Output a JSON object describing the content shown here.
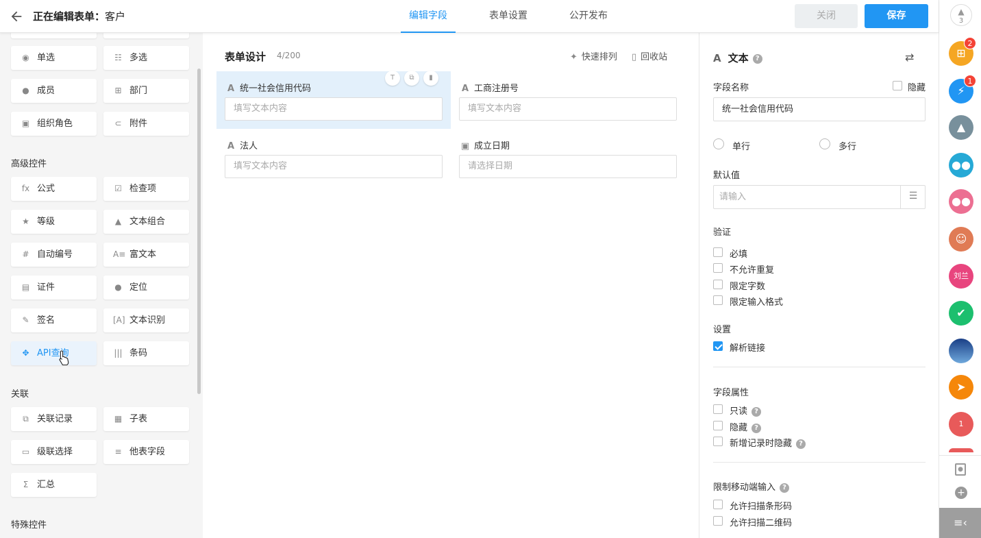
{
  "header": {
    "back_icon": "arrow-left-icon",
    "title_prefix": "正在编辑表单：",
    "title_name": "客户",
    "tabs": [
      {
        "label": "编辑字段",
        "active": true
      },
      {
        "label": "表单设置",
        "active": false
      },
      {
        "label": "公开发布",
        "active": false
      }
    ],
    "close_label": "关闭",
    "save_label": "保存",
    "accent_color": "#2196f3"
  },
  "controls": {
    "basic": [
      {
        "label": "单选",
        "icon": "radio-icon"
      },
      {
        "label": "多选",
        "icon": "checklist-icon"
      },
      {
        "label": "成员",
        "icon": "user-icon"
      },
      {
        "label": "部门",
        "icon": "org-tree-icon"
      },
      {
        "label": "组织角色",
        "icon": "role-icon"
      },
      {
        "label": "附件",
        "icon": "paperclip-icon"
      }
    ],
    "advanced_title": "高级控件",
    "advanced": [
      {
        "label": "公式",
        "icon": "fx-icon"
      },
      {
        "label": "检查项",
        "icon": "checkbox-icon"
      },
      {
        "label": "等级",
        "icon": "star-icon"
      },
      {
        "label": "文本组合",
        "icon": "shapes-icon"
      },
      {
        "label": "自动编号",
        "icon": "hash-icon"
      },
      {
        "label": "富文本",
        "icon": "richtext-icon"
      },
      {
        "label": "证件",
        "icon": "id-card-icon"
      },
      {
        "label": "定位",
        "icon": "location-pin-icon"
      },
      {
        "label": "签名",
        "icon": "signature-icon"
      },
      {
        "label": "文本识别",
        "icon": "ocr-icon"
      },
      {
        "label": "API查询",
        "icon": "api-icon",
        "highlight": true
      },
      {
        "label": "条码",
        "icon": "barcode-icon"
      }
    ],
    "relation_title": "关联",
    "relation": [
      {
        "label": "关联记录",
        "icon": "link-record-icon"
      },
      {
        "label": "子表",
        "icon": "table-icon"
      },
      {
        "label": "级联选择",
        "icon": "cascade-icon"
      },
      {
        "label": "他表字段",
        "icon": "lookup-icon"
      },
      {
        "label": "汇总",
        "icon": "sigma-icon"
      }
    ],
    "special_title": "特殊控件"
  },
  "form": {
    "title": "表单设计",
    "count": "4/200",
    "quick_arrange": "快速排列",
    "recycle": "回收站",
    "fields": [
      {
        "label": "统一社会信用代码",
        "placeholder": "填写文本内容",
        "icon": "text-a-icon",
        "selected": true
      },
      {
        "label": "工商注册号",
        "placeholder": "填写文本内容",
        "icon": "text-a-icon"
      },
      {
        "label": "法人",
        "placeholder": "填写文本内容",
        "icon": "text-a-icon"
      },
      {
        "label": "成立日期",
        "placeholder": "请选择日期",
        "icon": "calendar-icon"
      }
    ]
  },
  "props": {
    "type": "文本",
    "field_name_label": "字段名称",
    "hidden_label": "隐藏",
    "field_name_value": "统一社会信用代码",
    "single_line": "单行",
    "multi_line": "多行",
    "default_label": "默认值",
    "default_placeholder": "请输入",
    "validation_label": "验证",
    "validation": [
      "必填",
      "不允许重复",
      "限定字数",
      "限定输入格式"
    ],
    "settings_label": "设置",
    "parse_link": "解析链接",
    "attr_label": "字段属性",
    "attrs": [
      "只读",
      "隐藏",
      "新增记录时隐藏"
    ],
    "mobile_label": "限制移动端输入",
    "mobile": [
      "允许扫描条形码",
      "允许扫描二维码"
    ]
  },
  "sidebar": {
    "notify_count": "3",
    "badges": [
      "2",
      "1"
    ],
    "avatar_text": "刘兰",
    "calendar_day": "1"
  }
}
